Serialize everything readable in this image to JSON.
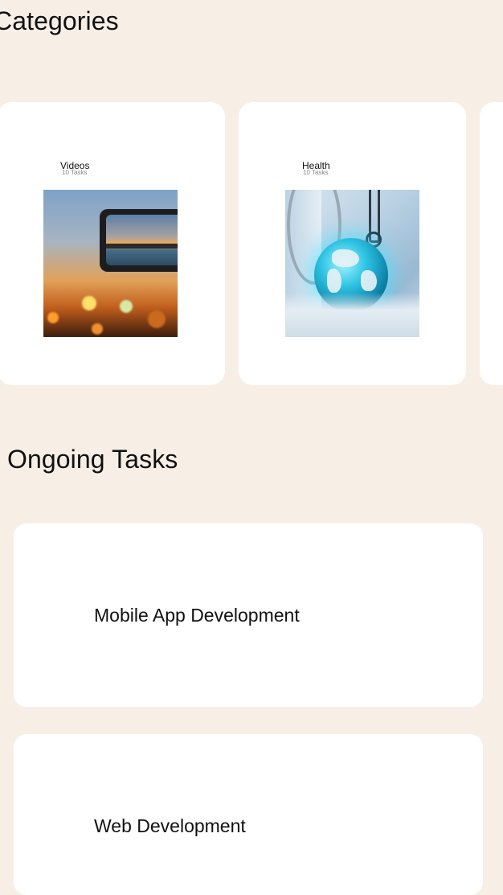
{
  "sections": {
    "categories_title": "Categories",
    "ongoing_title": "Ongoing Tasks"
  },
  "categories": [
    {
      "name": "Videos",
      "count": "10 Tasks",
      "image": "sunset-phone-photo"
    },
    {
      "name": "Health",
      "count": "10 Tasks",
      "image": "stethoscope-globe-photo"
    }
  ],
  "tasks": [
    {
      "label": "Mobile App Development"
    },
    {
      "label": "Web Development"
    }
  ],
  "colors": {
    "background": "#f7efe6",
    "card": "#ffffff",
    "text": "#111111",
    "muted": "#888888"
  }
}
